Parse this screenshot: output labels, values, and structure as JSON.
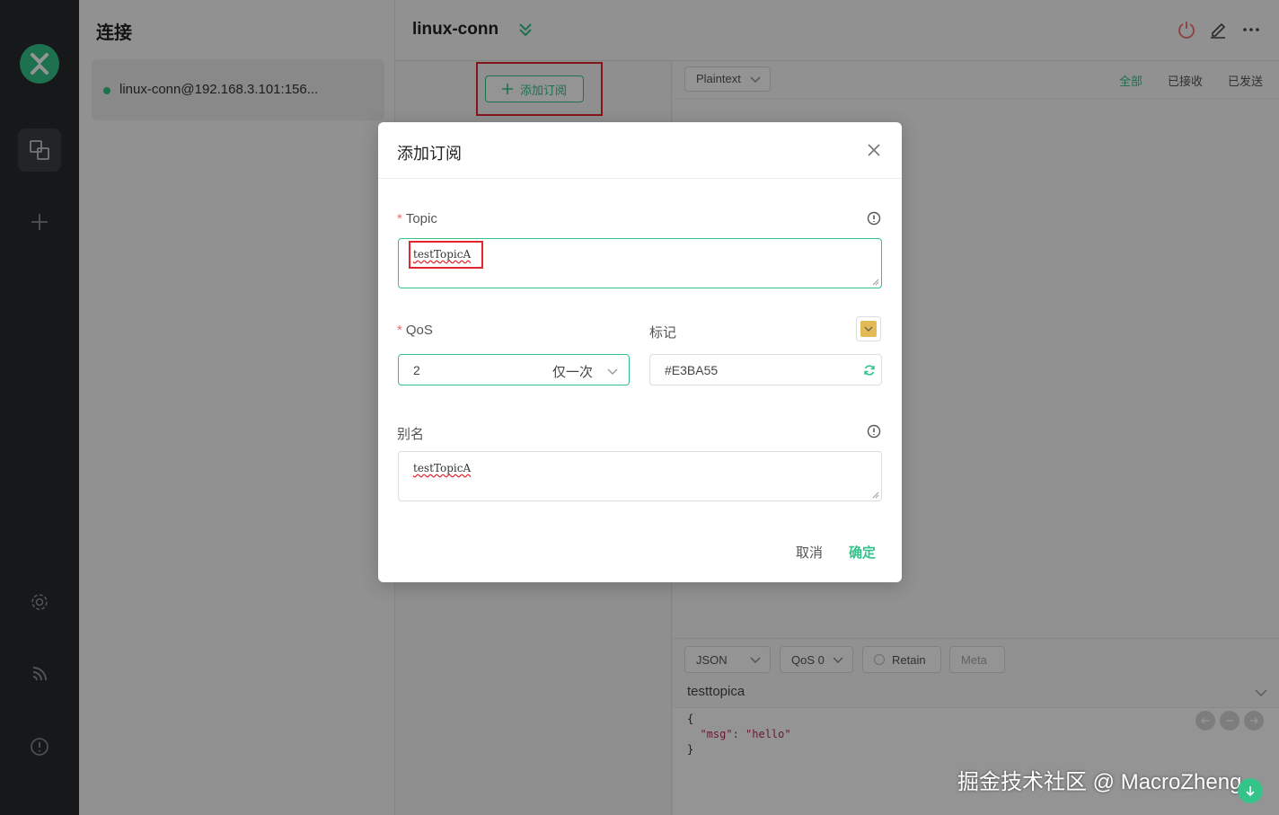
{
  "sidebar": {
    "connections_title": "连接",
    "connection_name": "linux-conn@192.168.3.101:156..."
  },
  "header": {
    "title": "linux-conn"
  },
  "subscriptions": {
    "add_label": "添加订阅"
  },
  "messages": {
    "format": "Plaintext",
    "filters": [
      "全部",
      "已接收",
      "已发送"
    ]
  },
  "publish": {
    "payload_type": "JSON",
    "qos": "QoS 0",
    "retain_label": "Retain",
    "meta_label": "Meta",
    "topic": "testtopica",
    "payload_lines": [
      "{",
      "  \"msg\": \"hello\"",
      "}"
    ]
  },
  "dialog": {
    "title": "添加订阅",
    "topic_label": "Topic",
    "topic_value": "testTopicA",
    "qos_label": "QoS",
    "qos_value": "2",
    "qos_desc": "仅一次",
    "mark_label": "标记",
    "color_value": "#E3BA55",
    "alias_label": "别名",
    "alias_value": "testTopicA",
    "cancel_label": "取消",
    "confirm_label": "确定"
  },
  "colors": {
    "accent": "#34c388",
    "mark_color": "#e3ba55",
    "highlight": "#e0262e"
  },
  "watermark": "掘金技术社区 @ MacroZheng"
}
